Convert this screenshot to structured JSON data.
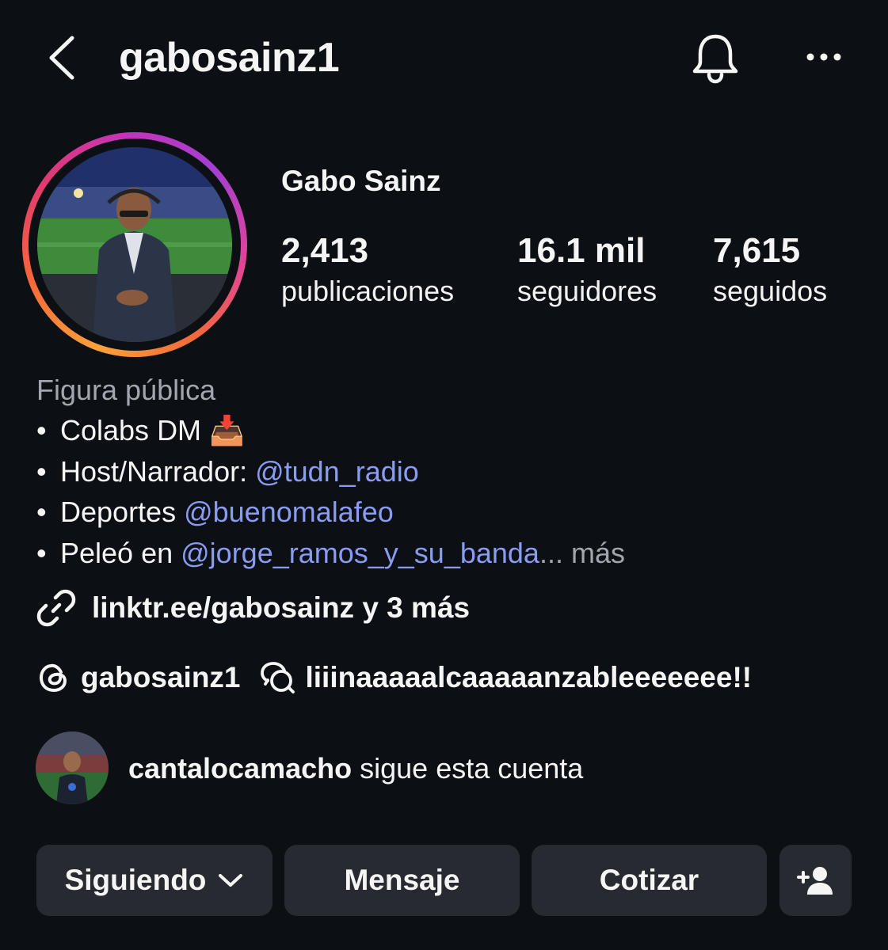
{
  "header": {
    "username": "gabosainz1",
    "back_icon": "chevron-left-icon",
    "notification_icon": "bell-icon",
    "more_icon": "more-horizontal-icon"
  },
  "profile": {
    "full_name": "Gabo Sainz",
    "stats": [
      {
        "value": "2,413",
        "label": "publicaciones"
      },
      {
        "value": "16.1 mil",
        "label": "seguidores"
      },
      {
        "value": "7,615",
        "label": "seguidos"
      }
    ],
    "avatar_ring_colors": [
      "#f9a23a",
      "#f5673a",
      "#e23a6f",
      "#c534b8",
      "#a340d0"
    ]
  },
  "bio": {
    "category": "Figura pública",
    "bullet": "•",
    "line1": {
      "text": "Colabs DM",
      "emoji": "📥"
    },
    "line2": {
      "text": "Host/Narrador: ",
      "mention": "@tudn_radio"
    },
    "line3": {
      "text": "Deportes ",
      "mention": "@buenomalafeo"
    },
    "line4": {
      "text": "Peleó en ",
      "mention": "@jorge_ramos_y_su_banda",
      "ellipsis": "...",
      "more": " más"
    },
    "mention_color": "#8a9cf2"
  },
  "link": {
    "icon": "link-icon",
    "text": "linktr.ee/gabosainz y 3 más"
  },
  "threads": {
    "threads_icon": "threads-icon",
    "handle": "gabosainz1",
    "chat_icon": "chat-bubbles-icon",
    "text": "liiinaaaaalcaaaaanzableeeeeee!!"
  },
  "followed_by": {
    "username": "cantalocamacho",
    "text": " sigue esta cuenta"
  },
  "buttons": {
    "following": "Siguiendo",
    "message": "Mensaje",
    "quote": "Cotizar",
    "add_user_icon": "add-person-icon",
    "background": "#272a31"
  }
}
